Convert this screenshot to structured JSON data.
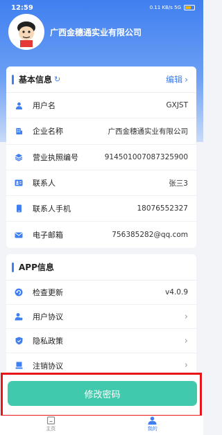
{
  "status": {
    "time": "12:59",
    "indicators": "0.11 KB/s  5G"
  },
  "profile": {
    "company": "广西金穗通实业有限公司"
  },
  "basic": {
    "title": "基本信息",
    "edit_label": "编辑",
    "rows": [
      {
        "icon": "user-icon",
        "label": "用户名",
        "value": "GXJST"
      },
      {
        "icon": "building-icon",
        "label": "企业名称",
        "value": "广西金穗通实业有限公司"
      },
      {
        "icon": "layers-icon",
        "label": "营业执照编号",
        "value": "914501007087325900"
      },
      {
        "icon": "id-card-icon",
        "label": "联系人",
        "value": "张三3"
      },
      {
        "icon": "phone-icon",
        "label": "联系人手机",
        "value": "18076552327"
      },
      {
        "icon": "mail-icon",
        "label": "电子邮箱",
        "value": "756385282@qq.com"
      }
    ]
  },
  "app": {
    "title": "APP信息",
    "rows": [
      {
        "icon": "update-icon",
        "label": "检查更新",
        "value": "v4.0.9"
      },
      {
        "icon": "user-agreement-icon",
        "label": "用户协议"
      },
      {
        "icon": "shield-icon",
        "label": "隐私政策"
      },
      {
        "icon": "cancel-account-icon",
        "label": "注销协议"
      }
    ]
  },
  "change_password_label": "修改密码",
  "tabs": [
    {
      "label": "主页",
      "active": false
    },
    {
      "label": "我的",
      "active": true
    }
  ],
  "colors": {
    "primary": "#3f7ff0",
    "button": "#40c9ac",
    "highlight": "#e8141a"
  }
}
